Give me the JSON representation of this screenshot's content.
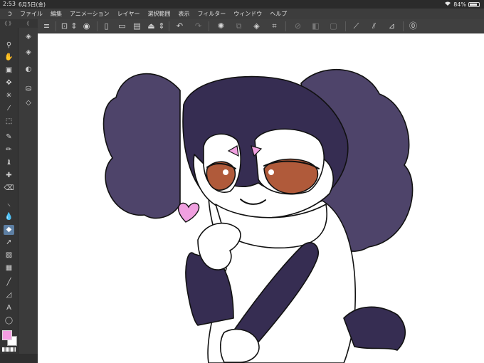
{
  "status": {
    "time": "2:53",
    "date": "6月5日(金)",
    "battery": "84%",
    "battery_level": 0.84
  },
  "menu": {
    "logo_icon": "clip-studio-logo-icon",
    "items": [
      "ファイル",
      "編集",
      "アニメーション",
      "レイヤー",
      "選択範囲",
      "表示",
      "フィルター",
      "ウィンドウ",
      "ヘルプ"
    ]
  },
  "panel_collapse": {
    "left1": "《 》",
    "left2": "《"
  },
  "colors": {
    "main": "#f29de0",
    "sub": "#ffffff",
    "hair": "#4e446a",
    "dark": "#362d52",
    "eye": "#b05a3a",
    "heart": "#f0a0e0"
  },
  "canvas": {
    "description_alt": ""
  }
}
